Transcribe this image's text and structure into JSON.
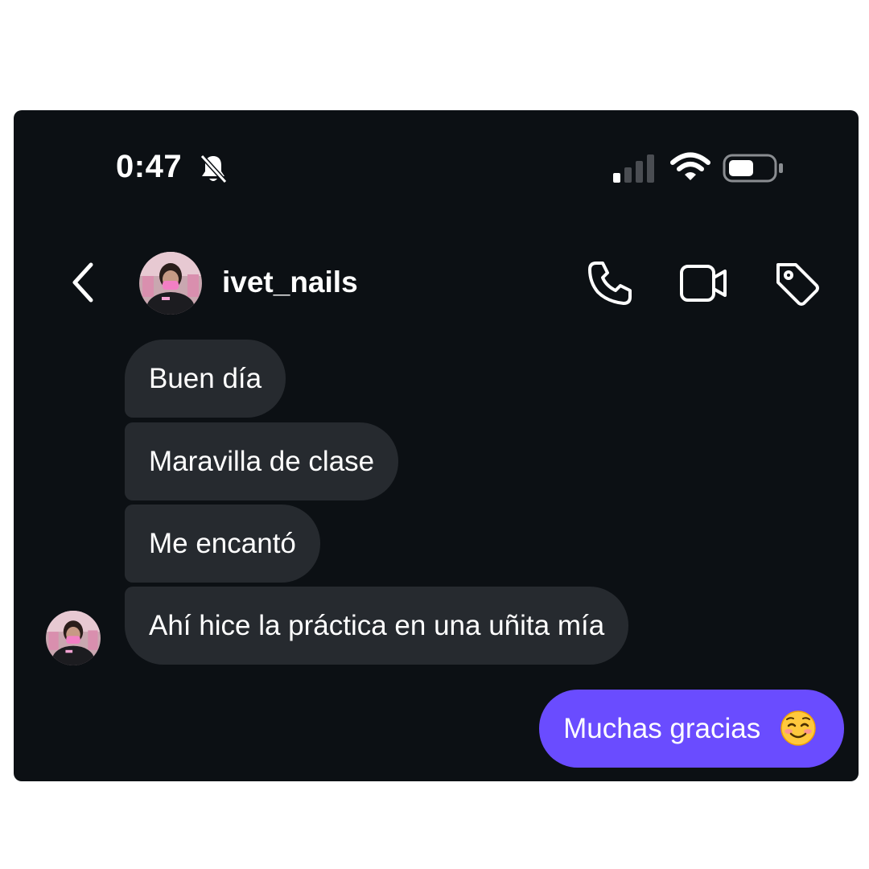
{
  "status_bar": {
    "time": "0:47",
    "icons": [
      "bell-slash-icon",
      "signal-icon",
      "wifi-icon",
      "battery-icon"
    ]
  },
  "header": {
    "username": "ivet_nails",
    "icons": [
      "back-chevron-icon",
      "phone-icon",
      "video-camera-icon",
      "tag-icon"
    ]
  },
  "messages": {
    "received": [
      "Buen día",
      "Maravilla de clase",
      "Me encantó",
      "Ahí hice la práctica en una uñita mía"
    ],
    "sent": [
      {
        "text": "Muchas gracias",
        "emoji": "smiling-face-emoji"
      }
    ]
  },
  "colors": {
    "background": "#0c1014",
    "received_bubble": "#262a2f",
    "sent_bubble": "#6a4cff",
    "text": "#ffffff"
  }
}
